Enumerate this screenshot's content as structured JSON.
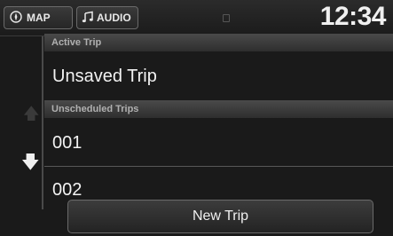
{
  "topbar": {
    "map_label": "MAP",
    "audio_label": "AUDIO",
    "clock": "12:34"
  },
  "active_trip": {
    "header": "Active Trip",
    "name": "Unsaved Trip"
  },
  "unscheduled": {
    "header": "Unscheduled Trips",
    "items": [
      "001",
      "002"
    ]
  },
  "actions": {
    "new_trip_label": "New Trip"
  }
}
